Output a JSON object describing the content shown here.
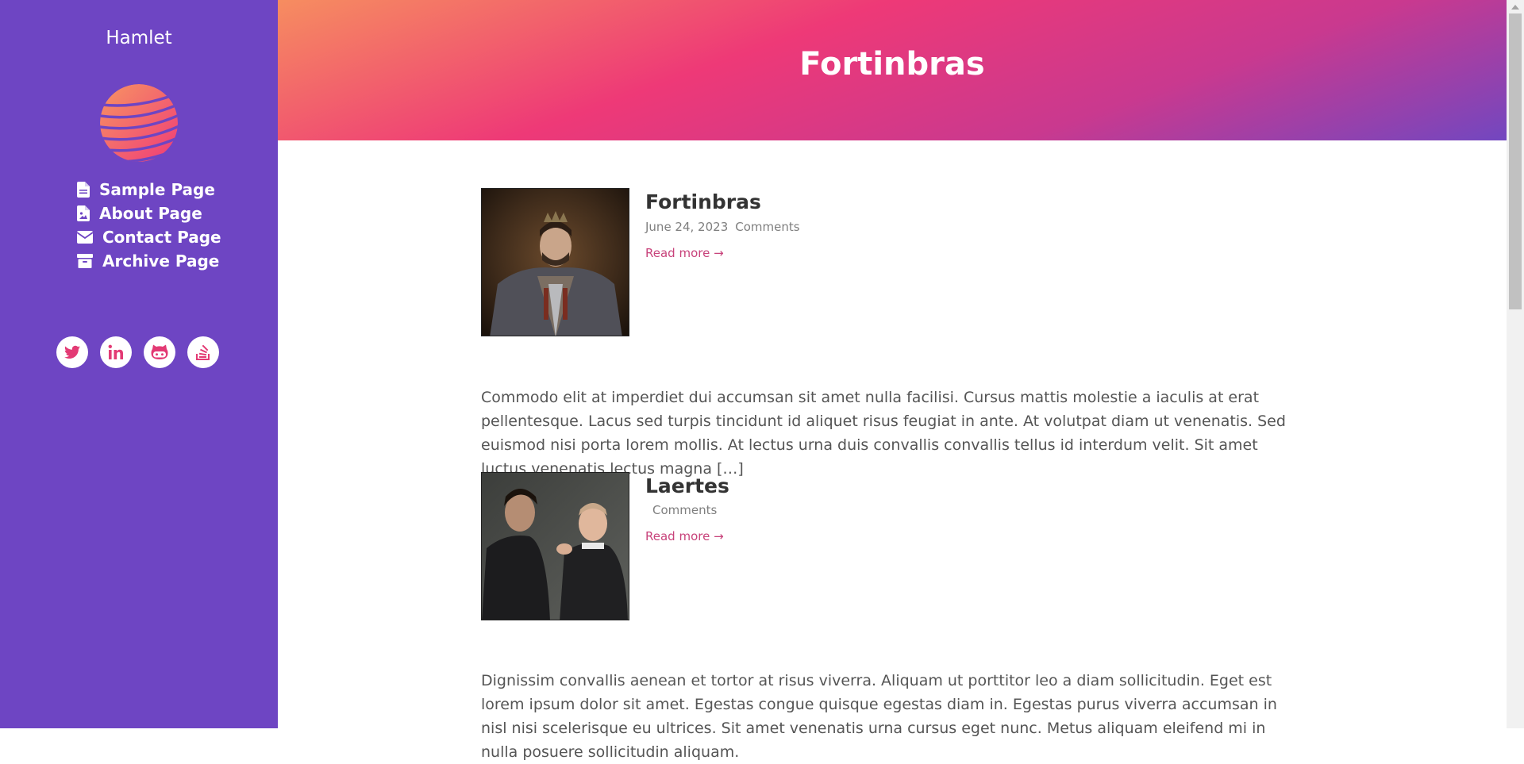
{
  "sidebar": {
    "site_title": "Hamlet",
    "nav": [
      {
        "label": "Sample Page",
        "icon": "file-icon"
      },
      {
        "label": "About Page",
        "icon": "file-image-icon"
      },
      {
        "label": "Contact Page",
        "icon": "envelope-icon"
      },
      {
        "label": "Archive Page",
        "icon": "archive-icon"
      }
    ],
    "socials": [
      "twitter-icon",
      "linkedin-icon",
      "github-icon",
      "stackoverflow-icon"
    ]
  },
  "hero": {
    "title": "Fortinbras"
  },
  "posts": [
    {
      "title": "Fortinbras",
      "date": "June 24, 2023",
      "comments": "Comments",
      "read_more": "Read more →",
      "excerpt": "Commodo elit at imperdiet dui accumsan sit amet nulla facilisi. Cursus mattis molestie a iaculis at erat pellentesque. Lacus sed turpis tincidunt id aliquet risus feugiat in ante. At volutpat diam ut venenatis. Sed euismod nisi porta lorem mollis. At lectus urna duis convallis convallis tellus id interdum velit. Sit amet luctus venenatis lectus magna […]"
    },
    {
      "title": "Laertes",
      "date": "",
      "comments": "Comments",
      "read_more": "Read more →",
      "excerpt": "Dignissim convallis aenean et tortor at risus viverra. Aliquam ut porttitor leo a diam sollicitudin. Eget est lorem ipsum dolor sit amet. Egestas congue quisque egestas diam in. Egestas purus viverra accumsan in nisl nisi scelerisque eu ultrices. Sit amet venenatis urna cursus eget nunc. Metus aliquam eleifend mi in nulla posuere sollicitudin aliquam."
    }
  ],
  "colors": {
    "sidebar_bg": "#6e45c3",
    "accent": "#ee3977",
    "link": "#c8437b"
  }
}
